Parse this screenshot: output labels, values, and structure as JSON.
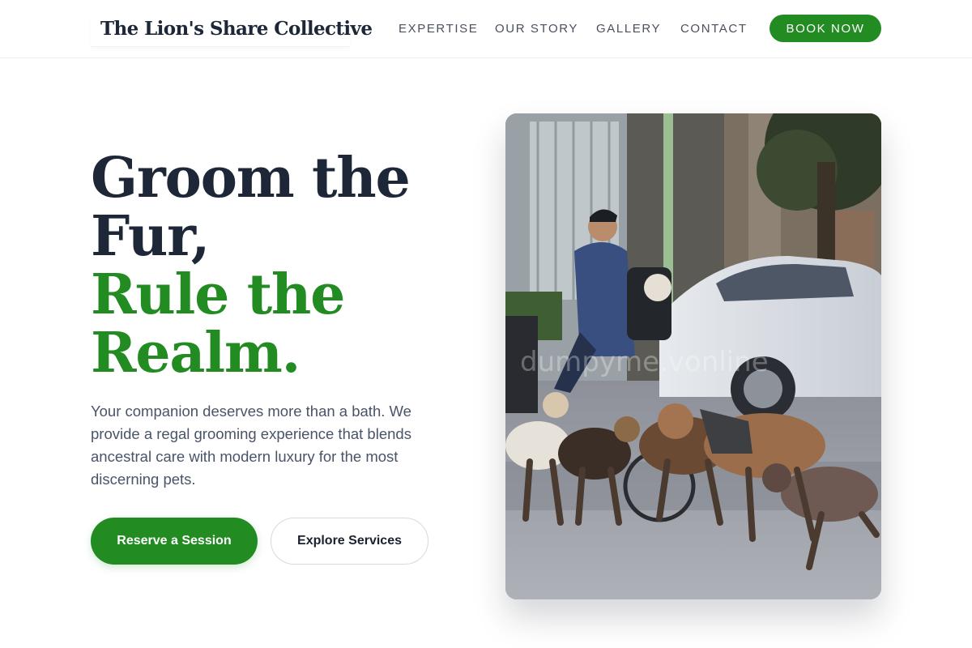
{
  "header": {
    "brand": "The Lion's Share Collective",
    "nav": [
      "EXPERTISE",
      "OUR STORY",
      "GALLERY",
      "CONTACT"
    ],
    "cta": "BOOK NOW"
  },
  "hero": {
    "headline_lines": [
      "Groom the",
      "Fur,"
    ],
    "accent_lines": [
      "Rule the",
      "Realm."
    ],
    "description": "Your companion deserves more than a bath. We provide a regal grooming experience that blends ancestral care with modern luxury for the most discerning pets.",
    "primary_button": "Reserve a Session",
    "secondary_button": "Explore Services",
    "image_watermark": "dumpyme.vonline"
  },
  "colors": {
    "accent": "#228b22",
    "heading": "#1d2738",
    "text": "#4a5468"
  },
  "icons": []
}
